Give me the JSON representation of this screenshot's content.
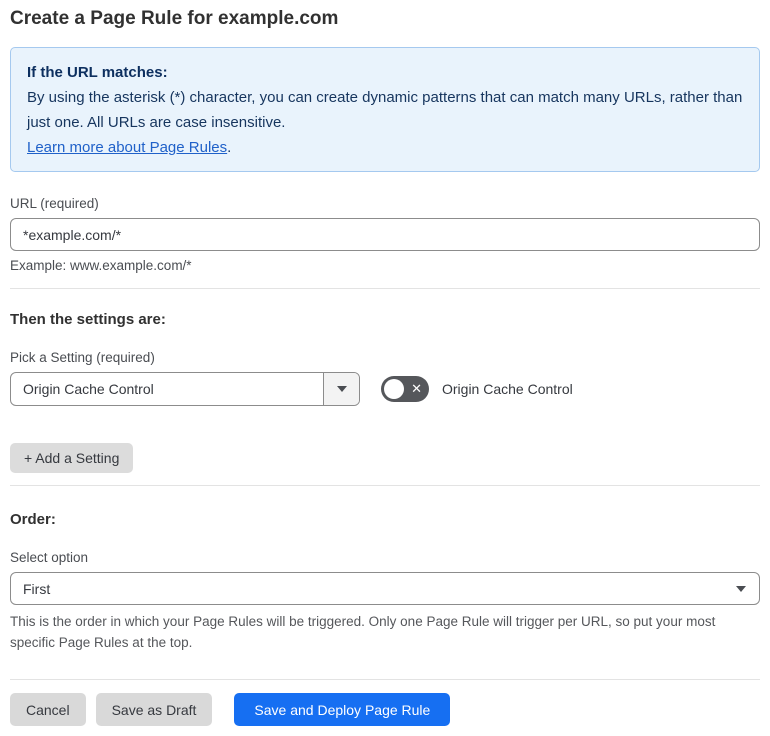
{
  "page": {
    "title": "Create a Page Rule for example.com"
  },
  "info_box": {
    "heading": "If the URL matches:",
    "body": "By using the asterisk (*) character, you can create dynamic patterns that can match many URLs, rather than just one. All URLs are case insensitive.",
    "link": "Learn more about Page Rules",
    "link_suffix": "."
  },
  "url_section": {
    "label": "URL (required)",
    "value": "*example.com/*",
    "example": "Example: www.example.com/*"
  },
  "settings_section": {
    "heading": "Then the settings are:",
    "picker_label": "Pick a Setting (required)",
    "picker_value": "Origin Cache Control",
    "toggle_label": "Origin Cache Control",
    "toggle_state": "off",
    "toggle_glyph": "✕",
    "add_button": "+ Add a Setting"
  },
  "order_section": {
    "heading": "Order:",
    "label": "Select option",
    "value": "First",
    "help": "This is the order in which your Page Rules will be triggered. Only one Page Rule will trigger per URL, so put your most specific Page Rules at the top."
  },
  "footer": {
    "cancel": "Cancel",
    "save_draft": "Save as Draft",
    "save_deploy": "Save and Deploy Page Rule"
  },
  "colors": {
    "accent_blue": "#166ff2",
    "info_bg": "#e9f3fc",
    "info_border": "#a5c9ef",
    "info_text": "#16355e",
    "link_blue": "#2061c9",
    "toggle_track": "#55575b",
    "button_gray": "#d9d9d9"
  }
}
